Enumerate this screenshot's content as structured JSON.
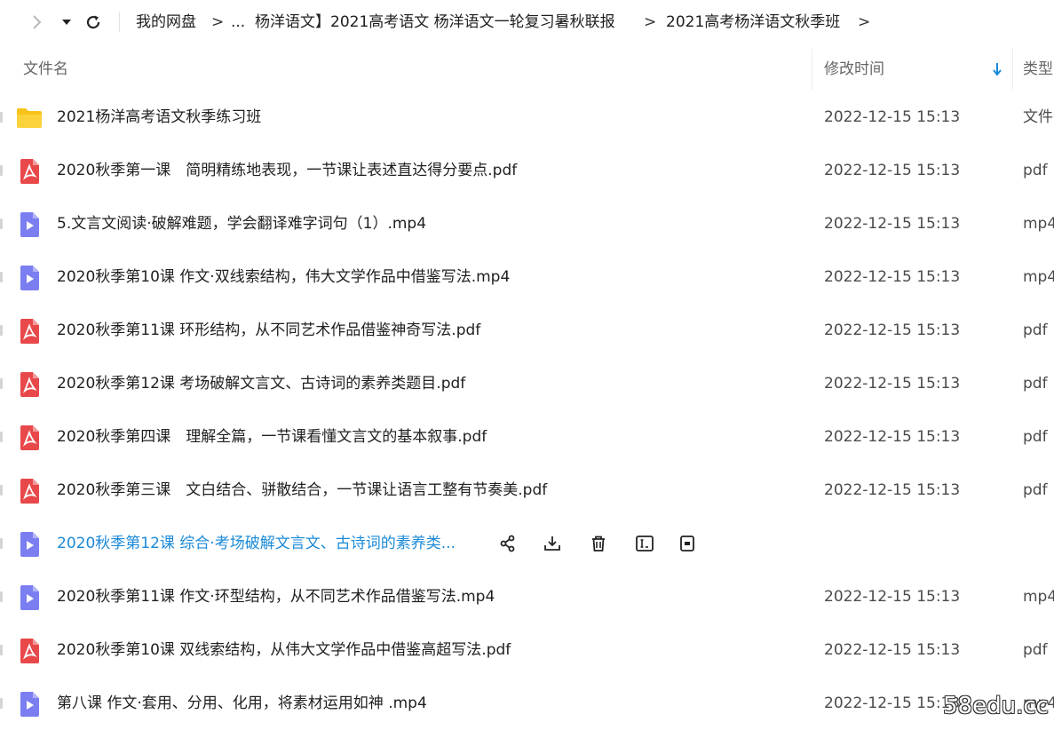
{
  "toolbar": {
    "back_icon": "chevron-right-icon",
    "dropdown_icon": "caret-down-icon",
    "refresh_icon": "refresh-icon"
  },
  "breadcrumb": {
    "root": "我的网盘",
    "ellipsis": "...",
    "parent": "杨洋语文】2021高考语文 杨洋语文一轮复习暑秋联报",
    "current": "2021高考杨洋语文秋季班",
    "separator": ">"
  },
  "columns": {
    "name": "文件名",
    "modified": "修改时间",
    "type": "类型"
  },
  "colors": {
    "folder": "#f7c31a",
    "pdf": "#e8484a",
    "video": "#7b7ef0",
    "active_link": "#1b8ad8",
    "sort_arrow": "#1b8ad8"
  },
  "files": [
    {
      "icon": "folder",
      "name": "2021杨洋高考语文秋季练习班",
      "modified": "2022-12-15 15:13",
      "type": "文件"
    },
    {
      "icon": "pdf",
      "name": "2020秋季第一课　简明精练地表现，一节课让表述直达得分要点.pdf",
      "modified": "2022-12-15 15:13",
      "type": "pdf"
    },
    {
      "icon": "video",
      "name": "5.文言文阅读·破解难题，学会翻译难字词句（1）.mp4",
      "modified": "2022-12-15 15:13",
      "type": "mp4"
    },
    {
      "icon": "video",
      "name": "2020秋季第10课 作文·双线索结构，伟大文学作品中借鉴写法.mp4",
      "modified": "2022-12-15 15:13",
      "type": "mp4"
    },
    {
      "icon": "pdf",
      "name": "2020秋季第11课 环形结构，从不同艺术作品借鉴神奇写法.pdf",
      "modified": "2022-12-15 15:13",
      "type": "pdf"
    },
    {
      "icon": "pdf",
      "name": "2020秋季第12课 考场破解文言文、古诗词的素养类题目.pdf",
      "modified": "2022-12-15 15:13",
      "type": "pdf"
    },
    {
      "icon": "pdf",
      "name": "2020秋季第四课　理解全篇，一节课看懂文言文的基本叙事.pdf",
      "modified": "2022-12-15 15:13",
      "type": "pdf"
    },
    {
      "icon": "pdf",
      "name": "2020秋季第三课　文白结合、骈散结合，一节课让语言工整有节奏美.pdf",
      "modified": "2022-12-15 15:13",
      "type": "pdf"
    },
    {
      "icon": "video",
      "name": "2020秋季第12课 综合·考场破解文言文、古诗词的素养类...",
      "modified": "",
      "type": "",
      "hovered": true
    },
    {
      "icon": "video",
      "name": "2020秋季第11课 作文·环型结构，从不同艺术作品借鉴写法.mp4",
      "modified": "2022-12-15 15:13",
      "type": "mp4"
    },
    {
      "icon": "pdf",
      "name": "2020秋季第10课 双线索结构，从伟大文学作品中借鉴高超写法.pdf",
      "modified": "2022-12-15 15:13",
      "type": "pdf"
    },
    {
      "icon": "video",
      "name": "第八课 作文·套用、分用、化用，将素材运用如神 .mp4",
      "modified": "2022-12-15 15:13",
      "type": "mp4"
    }
  ],
  "row_actions": [
    "share-icon",
    "download-icon",
    "delete-icon",
    "rename-icon",
    "more-icon"
  ],
  "watermark": "58edu.cc"
}
